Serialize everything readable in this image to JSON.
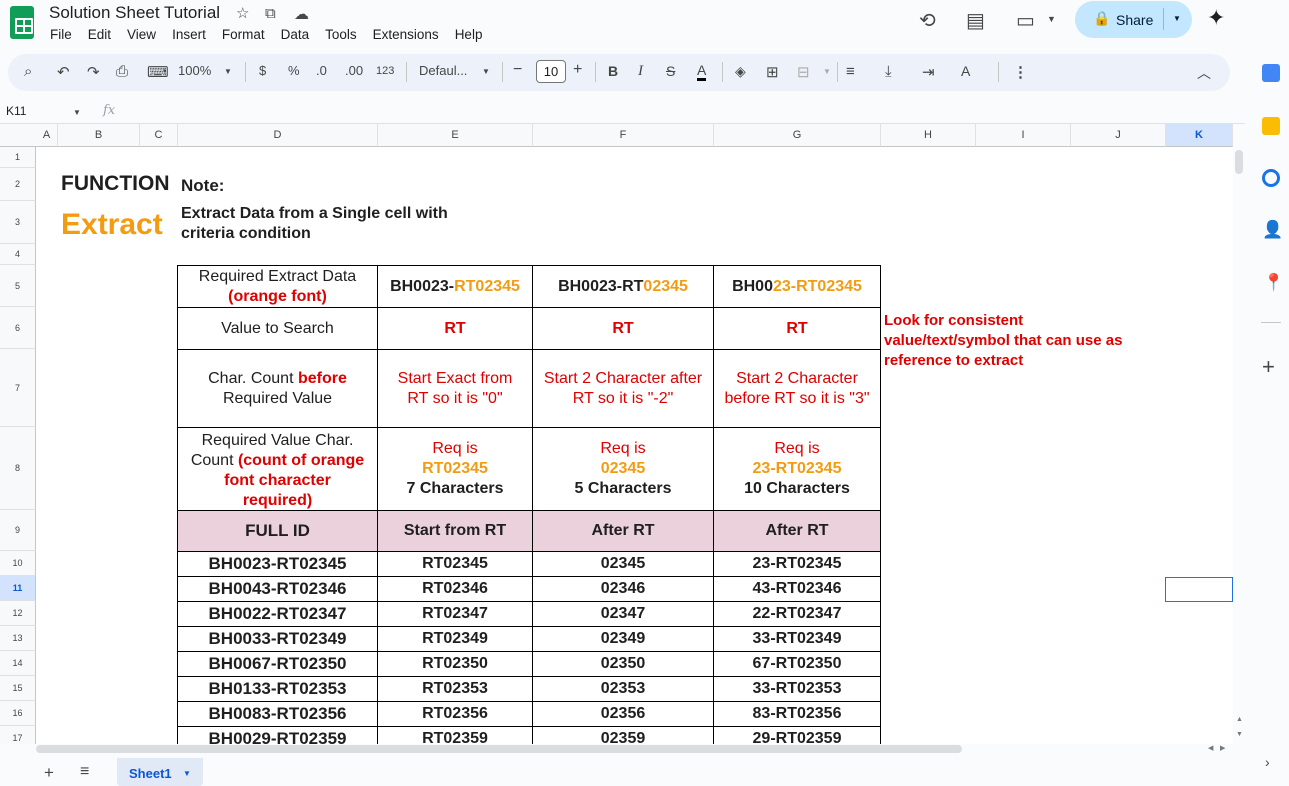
{
  "doc": {
    "title": "Solution Sheet Tutorial"
  },
  "menu": [
    "File",
    "Edit",
    "View",
    "Insert",
    "Format",
    "Data",
    "Tools",
    "Extensions",
    "Help"
  ],
  "header": {
    "share_label": "Share"
  },
  "toolbar": {
    "zoom": "100%",
    "currency": "$",
    "percent": "%",
    "dec_decrease": ".0",
    "dec_increase": ".00",
    "number_format": "123",
    "font": "Defaul...",
    "font_size": "10",
    "bold": "B",
    "italic": "I",
    "minus": "−",
    "plus": "+"
  },
  "formula_bar": {
    "cell_ref": "K11",
    "fx": "fx"
  },
  "columns": [
    "A",
    "B",
    "C",
    "D",
    "E",
    "F",
    "G",
    "H",
    "I",
    "J",
    "K"
  ],
  "rows": [
    "1",
    "2",
    "3",
    "4",
    "5",
    "6",
    "7",
    "8",
    "9",
    "10",
    "11",
    "12",
    "13",
    "14",
    "15",
    "16",
    "17"
  ],
  "sheet": {
    "function_label": "FUNCTION",
    "extract_label": "Extract",
    "note_label": "Note:",
    "note_text_1": "Extract Data from a Single cell with",
    "note_text_2": "criteria condition",
    "side_note_1": "Look for consistent",
    "side_note_2": "value/text/symbol that can use as",
    "side_note_3": "reference to  extract",
    "r5": {
      "label_1": "Required Extract Data",
      "label_2": "(orange font)",
      "e_black": "BH0023-",
      "e_orange": "RT02345",
      "f_black": "BH0023-RT",
      "f_orange": "02345",
      "g_black": "BH00",
      "g_orange": "23-RT02345"
    },
    "r6": {
      "label": "Value to Search",
      "e": "RT",
      "f": "RT",
      "g": "RT"
    },
    "r7": {
      "label_1": "Char. Count ",
      "label_red": "before",
      "label_2": "Required Value",
      "e_1": "Start Exact from",
      "e_2": "RT so it is \"0\"",
      "f_1": "Start 2 Character after",
      "f_2": "RT so it is \"-2\"",
      "g_1": "Start 2 Character",
      "g_2": "before RT so it is \"3\""
    },
    "r8": {
      "label_1": "Required Value Char.",
      "label_2": "Count ",
      "label_red_1": "(count of orange",
      "label_red_2": "font character",
      "label_red_3": "required)",
      "req": "Req is",
      "e_val": "RT02345",
      "e_chars": "7 Characters",
      "f_val": "02345",
      "f_chars": "5 Characters",
      "g_val": "23-RT02345",
      "g_chars": "10 Characters"
    },
    "r9": {
      "d": "FULL ID",
      "e": "Start from RT",
      "f": "After RT",
      "g": "After RT"
    },
    "data": [
      [
        "BH0023-RT02345",
        "RT02345",
        "02345",
        "23-RT02345"
      ],
      [
        "BH0043-RT02346",
        "RT02346",
        "02346",
        "43-RT02346"
      ],
      [
        "BH0022-RT02347",
        "RT02347",
        "02347",
        "22-RT02347"
      ],
      [
        "BH0033-RT02349",
        "RT02349",
        "02349",
        "33-RT02349"
      ],
      [
        "BH0067-RT02350",
        "RT02350",
        "02350",
        "67-RT02350"
      ],
      [
        "BH0133-RT02353",
        "RT02353",
        "02353",
        "33-RT02353"
      ],
      [
        "BH0083-RT02356",
        "RT02356",
        "02356",
        "83-RT02356"
      ],
      [
        "BH0029-RT02359",
        "RT02359",
        "02359",
        "29-RT02359"
      ]
    ]
  },
  "tabs": {
    "sheet1": "Sheet1"
  },
  "colors": {
    "orange": "#f39c12",
    "red": "#e00000",
    "header_fill": "#ead1dc",
    "accent": "#0b57d0"
  }
}
